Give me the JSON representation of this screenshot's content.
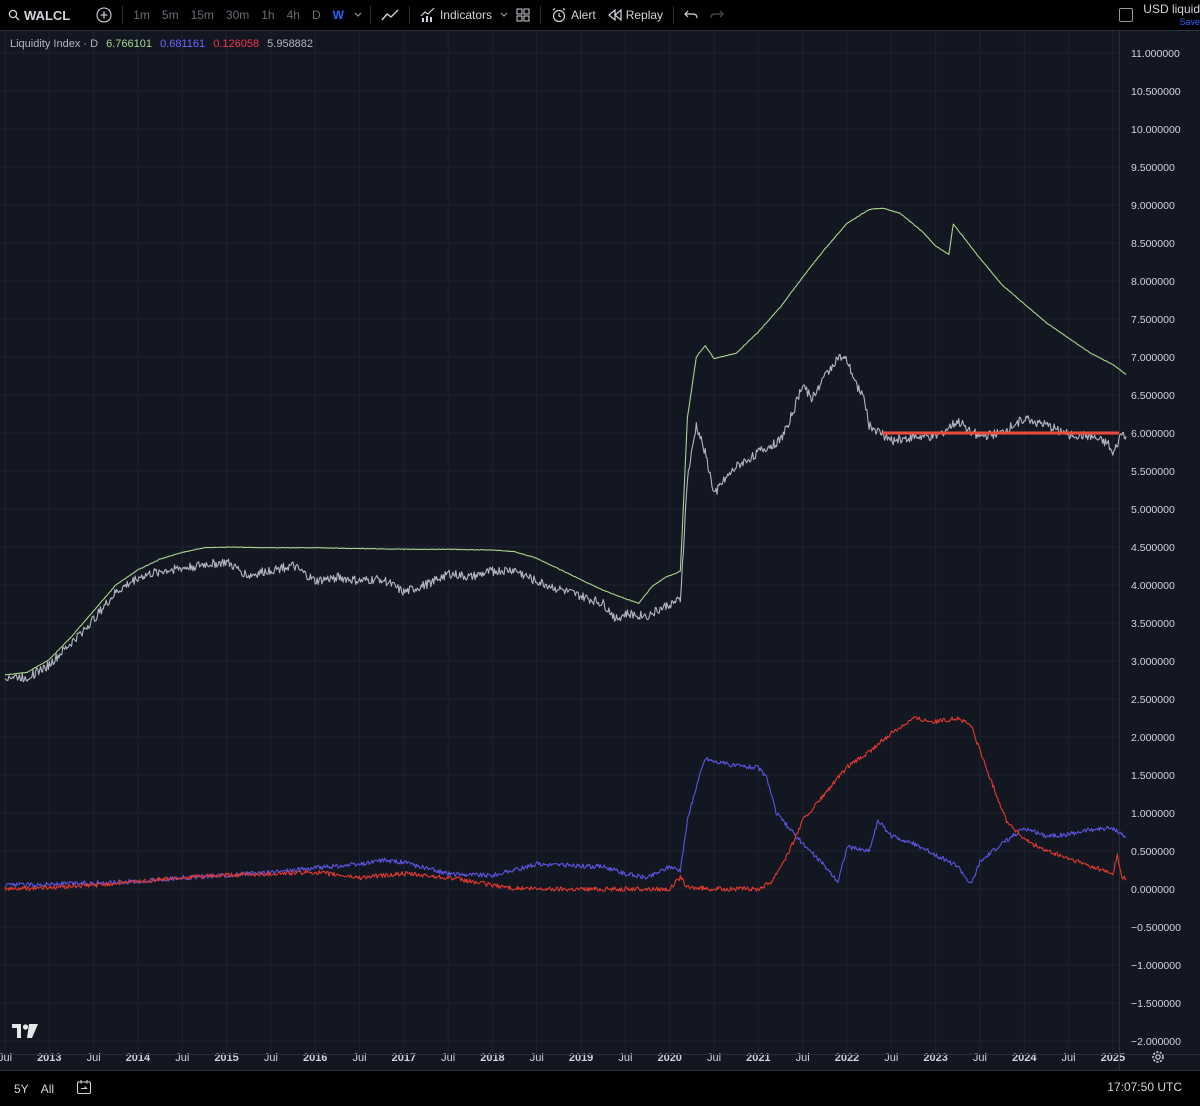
{
  "toolbar": {
    "symbol": "WALCL",
    "intervals": [
      "1m",
      "5m",
      "15m",
      "30m",
      "1h",
      "4h",
      "D",
      "W"
    ],
    "active_interval": "W",
    "indicators_label": "Indicators",
    "alert_label": "Alert",
    "replay_label": "Replay",
    "layout_name": "USD liquid",
    "save_label": "Save"
  },
  "legend": {
    "title": "Liquidity Index · D",
    "v1": "6.766101",
    "v2": "0.681161",
    "v3": "0.126058",
    "v4": "5.958882"
  },
  "bottom": {
    "range_5y": "5Y",
    "range_all": "All",
    "clock": "17:07:50 UTC"
  },
  "colors": {
    "background": "#131722",
    "grid": "#1f2330",
    "green": "#a5d68a",
    "blue": "#5b55e0",
    "red": "#e23a2e",
    "gray": "#b4b6c2",
    "hline": "#f04a3e"
  },
  "chart_data": {
    "type": "line",
    "y_ticks": [
      "11.000000",
      "10.500000",
      "10.000000",
      "9.500000",
      "9.000000",
      "8.500000",
      "8.000000",
      "7.500000",
      "7.000000",
      "6.500000",
      "6.000000",
      "5.500000",
      "5.000000",
      "4.500000",
      "4.000000",
      "3.500000",
      "3.000000",
      "2.500000",
      "2.000000",
      "1.500000",
      "1.000000",
      "0.500000",
      "0.000000",
      "−0.500000",
      "−1.000000",
      "−1.500000",
      "−2.000000"
    ],
    "ylim": [
      -2.0,
      11.0
    ],
    "x_ticks": [
      {
        "label": "Jul",
        "t": 2012.5,
        "year": false
      },
      {
        "label": "2013",
        "t": 2013.0,
        "year": true
      },
      {
        "label": "Jul",
        "t": 2013.5,
        "year": false
      },
      {
        "label": "2014",
        "t": 2014.0,
        "year": true
      },
      {
        "label": "Jul",
        "t": 2014.5,
        "year": false
      },
      {
        "label": "2015",
        "t": 2015.0,
        "year": true
      },
      {
        "label": "Jul",
        "t": 2015.5,
        "year": false
      },
      {
        "label": "2016",
        "t": 2016.0,
        "year": true
      },
      {
        "label": "Jul",
        "t": 2016.5,
        "year": false
      },
      {
        "label": "2017",
        "t": 2017.0,
        "year": true
      },
      {
        "label": "Jul",
        "t": 2017.5,
        "year": false
      },
      {
        "label": "2018",
        "t": 2018.0,
        "year": true
      },
      {
        "label": "Jul",
        "t": 2018.5,
        "year": false
      },
      {
        "label": "2019",
        "t": 2019.0,
        "year": true
      },
      {
        "label": "Jul",
        "t": 2019.5,
        "year": false
      },
      {
        "label": "2020",
        "t": 2020.0,
        "year": true
      },
      {
        "label": "Jul",
        "t": 2020.5,
        "year": false
      },
      {
        "label": "2021",
        "t": 2021.0,
        "year": true
      },
      {
        "label": "Jul",
        "t": 2021.5,
        "year": false
      },
      {
        "label": "2022",
        "t": 2022.0,
        "year": true
      },
      {
        "label": "Jul",
        "t": 2022.5,
        "year": false
      },
      {
        "label": "2023",
        "t": 2023.0,
        "year": true
      },
      {
        "label": "Jul",
        "t": 2023.5,
        "year": false
      },
      {
        "label": "2024",
        "t": 2024.0,
        "year": true
      },
      {
        "label": "Jul",
        "t": 2024.5,
        "year": false
      },
      {
        "label": "2025",
        "t": 2025.0,
        "year": true
      }
    ],
    "xlim": [
      2012.5,
      2025.25
    ],
    "series": [
      {
        "color": "#a5d68a",
        "points": [
          [
            2012.5,
            2.82
          ],
          [
            2012.75,
            2.85
          ],
          [
            2013.0,
            3.02
          ],
          [
            2013.25,
            3.32
          ],
          [
            2013.5,
            3.66
          ],
          [
            2013.75,
            4.0
          ],
          [
            2014.0,
            4.2
          ],
          [
            2014.25,
            4.34
          ],
          [
            2014.5,
            4.43
          ],
          [
            2014.75,
            4.49
          ],
          [
            2015.0,
            4.5
          ],
          [
            2015.5,
            4.49
          ],
          [
            2016.0,
            4.49
          ],
          [
            2016.5,
            4.48
          ],
          [
            2017.0,
            4.47
          ],
          [
            2017.5,
            4.47
          ],
          [
            2018.0,
            4.46
          ],
          [
            2018.25,
            4.44
          ],
          [
            2018.5,
            4.35
          ],
          [
            2018.75,
            4.21
          ],
          [
            2019.0,
            4.07
          ],
          [
            2019.25,
            3.93
          ],
          [
            2019.5,
            3.82
          ],
          [
            2019.65,
            3.76
          ],
          [
            2019.8,
            3.98
          ],
          [
            2019.95,
            4.1
          ],
          [
            2020.12,
            4.18
          ],
          [
            2020.2,
            6.2
          ],
          [
            2020.3,
            7.0
          ],
          [
            2020.4,
            7.15
          ],
          [
            2020.5,
            6.98
          ],
          [
            2020.75,
            7.05
          ],
          [
            2021.0,
            7.33
          ],
          [
            2021.25,
            7.66
          ],
          [
            2021.5,
            8.05
          ],
          [
            2021.75,
            8.42
          ],
          [
            2022.0,
            8.76
          ],
          [
            2022.25,
            8.94
          ],
          [
            2022.4,
            8.96
          ],
          [
            2022.6,
            8.89
          ],
          [
            2022.85,
            8.65
          ],
          [
            2023.0,
            8.46
          ],
          [
            2023.15,
            8.35
          ],
          [
            2023.2,
            8.75
          ],
          [
            2023.3,
            8.6
          ],
          [
            2023.5,
            8.3
          ],
          [
            2023.75,
            7.95
          ],
          [
            2024.0,
            7.7
          ],
          [
            2024.25,
            7.45
          ],
          [
            2024.5,
            7.25
          ],
          [
            2024.75,
            7.05
          ],
          [
            2025.0,
            6.9
          ],
          [
            2025.15,
            6.77
          ]
        ]
      },
      {
        "color": "#b4b6c2",
        "points": [
          [
            2012.5,
            2.8
          ],
          [
            2012.75,
            2.78
          ],
          [
            2013.0,
            2.95
          ],
          [
            2013.25,
            3.24
          ],
          [
            2013.5,
            3.55
          ],
          [
            2013.75,
            3.9
          ],
          [
            2014.0,
            4.1
          ],
          [
            2014.25,
            4.18
          ],
          [
            2014.5,
            4.22
          ],
          [
            2014.75,
            4.27
          ],
          [
            2015.0,
            4.3
          ],
          [
            2015.25,
            4.12
          ],
          [
            2015.5,
            4.2
          ],
          [
            2015.75,
            4.25
          ],
          [
            2016.0,
            4.05
          ],
          [
            2016.25,
            4.1
          ],
          [
            2016.5,
            4.05
          ],
          [
            2016.75,
            4.08
          ],
          [
            2017.0,
            3.9
          ],
          [
            2017.25,
            4.0
          ],
          [
            2017.5,
            4.15
          ],
          [
            2017.75,
            4.1
          ],
          [
            2018.0,
            4.18
          ],
          [
            2018.25,
            4.2
          ],
          [
            2018.5,
            4.05
          ],
          [
            2018.75,
            3.95
          ],
          [
            2019.0,
            3.85
          ],
          [
            2019.25,
            3.75
          ],
          [
            2019.4,
            3.55
          ],
          [
            2019.5,
            3.62
          ],
          [
            2019.75,
            3.6
          ],
          [
            2020.0,
            3.75
          ],
          [
            2020.12,
            3.8
          ],
          [
            2020.2,
            5.4
          ],
          [
            2020.3,
            6.1
          ],
          [
            2020.4,
            5.75
          ],
          [
            2020.5,
            5.2
          ],
          [
            2020.6,
            5.35
          ],
          [
            2020.75,
            5.55
          ],
          [
            2021.0,
            5.75
          ],
          [
            2021.25,
            5.9
          ],
          [
            2021.4,
            6.3
          ],
          [
            2021.5,
            6.65
          ],
          [
            2021.6,
            6.45
          ],
          [
            2021.75,
            6.75
          ],
          [
            2021.9,
            7.0
          ],
          [
            2022.0,
            6.95
          ],
          [
            2022.1,
            6.65
          ],
          [
            2022.2,
            6.45
          ],
          [
            2022.25,
            6.1
          ],
          [
            2022.5,
            5.9
          ],
          [
            2022.75,
            5.95
          ],
          [
            2023.0,
            5.95
          ],
          [
            2023.25,
            6.15
          ],
          [
            2023.5,
            5.95
          ],
          [
            2023.75,
            6.0
          ],
          [
            2024.0,
            6.2
          ],
          [
            2024.25,
            6.1
          ],
          [
            2024.5,
            5.98
          ],
          [
            2024.75,
            5.95
          ],
          [
            2024.95,
            5.85
          ],
          [
            2025.0,
            5.7
          ],
          [
            2025.1,
            6.0
          ],
          [
            2025.15,
            5.96
          ]
        ]
      },
      {
        "color": "#5b55e0",
        "points": [
          [
            2012.5,
            0.05
          ],
          [
            2013.0,
            0.06
          ],
          [
            2013.5,
            0.08
          ],
          [
            2014.0,
            0.1
          ],
          [
            2014.5,
            0.15
          ],
          [
            2015.0,
            0.18
          ],
          [
            2015.5,
            0.22
          ],
          [
            2016.0,
            0.28
          ],
          [
            2016.5,
            0.32
          ],
          [
            2016.75,
            0.38
          ],
          [
            2017.0,
            0.35
          ],
          [
            2017.5,
            0.2
          ],
          [
            2018.0,
            0.18
          ],
          [
            2018.25,
            0.25
          ],
          [
            2018.5,
            0.33
          ],
          [
            2018.75,
            0.32
          ],
          [
            2019.0,
            0.3
          ],
          [
            2019.25,
            0.3
          ],
          [
            2019.5,
            0.2
          ],
          [
            2019.75,
            0.15
          ],
          [
            2020.0,
            0.3
          ],
          [
            2020.12,
            0.25
          ],
          [
            2020.2,
            0.9
          ],
          [
            2020.3,
            1.35
          ],
          [
            2020.4,
            1.72
          ],
          [
            2020.5,
            1.68
          ],
          [
            2020.75,
            1.62
          ],
          [
            2021.0,
            1.6
          ],
          [
            2021.1,
            1.45
          ],
          [
            2021.2,
            1.0
          ],
          [
            2021.35,
            0.8
          ],
          [
            2021.5,
            0.6
          ],
          [
            2021.75,
            0.3
          ],
          [
            2021.9,
            0.1
          ],
          [
            2022.0,
            0.55
          ],
          [
            2022.25,
            0.5
          ],
          [
            2022.35,
            0.9
          ],
          [
            2022.5,
            0.7
          ],
          [
            2022.75,
            0.6
          ],
          [
            2023.0,
            0.45
          ],
          [
            2023.25,
            0.3
          ],
          [
            2023.4,
            0.05
          ],
          [
            2023.5,
            0.35
          ],
          [
            2023.75,
            0.6
          ],
          [
            2024.0,
            0.8
          ],
          [
            2024.25,
            0.7
          ],
          [
            2024.5,
            0.72
          ],
          [
            2024.75,
            0.78
          ],
          [
            2025.0,
            0.8
          ],
          [
            2025.15,
            0.68
          ]
        ]
      },
      {
        "color": "#e23a2e",
        "points": [
          [
            2012.5,
            0.0
          ],
          [
            2013.0,
            0.02
          ],
          [
            2013.5,
            0.05
          ],
          [
            2014.0,
            0.1
          ],
          [
            2014.5,
            0.15
          ],
          [
            2015.0,
            0.18
          ],
          [
            2015.5,
            0.2
          ],
          [
            2016.0,
            0.22
          ],
          [
            2016.5,
            0.15
          ],
          [
            2017.0,
            0.2
          ],
          [
            2017.5,
            0.15
          ],
          [
            2018.0,
            0.05
          ],
          [
            2018.25,
            0.01
          ],
          [
            2018.5,
            0.0
          ],
          [
            2019.0,
            0.0
          ],
          [
            2019.5,
            0.0
          ],
          [
            2020.0,
            0.0
          ],
          [
            2020.12,
            0.15
          ],
          [
            2020.2,
            0.02
          ],
          [
            2020.5,
            0.0
          ],
          [
            2021.0,
            0.0
          ],
          [
            2021.15,
            0.1
          ],
          [
            2021.35,
            0.5
          ],
          [
            2021.5,
            0.9
          ],
          [
            2021.75,
            1.25
          ],
          [
            2022.0,
            1.6
          ],
          [
            2022.25,
            1.8
          ],
          [
            2022.5,
            2.05
          ],
          [
            2022.75,
            2.25
          ],
          [
            2023.0,
            2.2
          ],
          [
            2023.25,
            2.25
          ],
          [
            2023.4,
            2.15
          ],
          [
            2023.6,
            1.5
          ],
          [
            2023.8,
            0.9
          ],
          [
            2024.0,
            0.65
          ],
          [
            2024.25,
            0.5
          ],
          [
            2024.5,
            0.4
          ],
          [
            2024.75,
            0.3
          ],
          [
            2025.0,
            0.2
          ],
          [
            2025.05,
            0.45
          ],
          [
            2025.1,
            0.15
          ],
          [
            2025.15,
            0.13
          ]
        ]
      }
    ],
    "hline": {
      "y": 6.0,
      "x_start": 2022.4,
      "x_end": 2025.25,
      "color": "#f04a3e"
    }
  }
}
